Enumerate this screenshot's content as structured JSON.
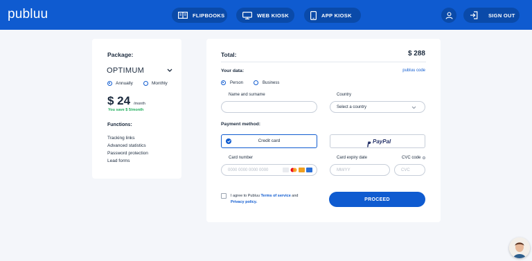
{
  "header": {
    "logo": "publuu",
    "nav": [
      {
        "label": "FLIPBOOKS"
      },
      {
        "label": "WEB KIOSK"
      },
      {
        "label": "APP KIOSK"
      }
    ],
    "signout_label": "SIGN OUT",
    "brand_color": "#0f5bd0"
  },
  "package_card": {
    "title": "Package:",
    "plan": "OPTIMUM",
    "billing": [
      {
        "label": "Annually",
        "selected": true
      },
      {
        "label": "Monthly",
        "selected": false
      }
    ],
    "price": "$ 24",
    "per": "/month",
    "savings": "You save $ 5/month",
    "functions_title": "Functions:",
    "functions": [
      "Tracking links",
      "Advanced statistics",
      "Password protection",
      "Lead forms"
    ]
  },
  "order_card": {
    "total_label": "Total:",
    "total_value": "$ 288",
    "your_data_label": "Your data:",
    "code_link": "publuu code",
    "customer_types": [
      {
        "label": "Person",
        "selected": true
      },
      {
        "label": "Business",
        "selected": false
      }
    ],
    "name_label": "Name and surname",
    "name_value": "",
    "country_label": "Country",
    "country_placeholder": "Select a country",
    "payment_method_label": "Payment method:",
    "credit_card_label": "Credit card",
    "paypal_label": "PayPal",
    "card_number_label": "Card number",
    "card_number_placeholder": "0000 0000 0000 0000",
    "expiry_label": "Card expiry date",
    "expiry_placeholder": "MM/YY",
    "cvc_label": "CVC code",
    "cvc_placeholder": "CVC",
    "terms_prefix": "I agree to Publuu",
    "terms_link": "Terms of service",
    "terms_and": "and",
    "privacy_link": "Privacy policy.",
    "proceed_label": "PROCEED",
    "accent_color": "#0f5bd0",
    "savings_color": "#1fae5b"
  }
}
